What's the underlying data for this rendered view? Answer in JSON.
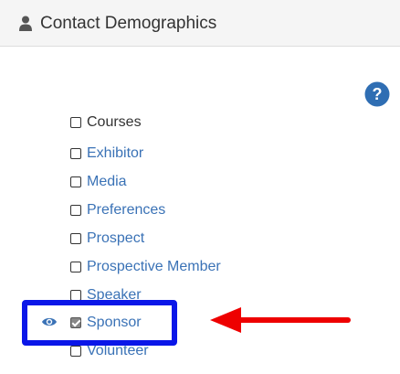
{
  "header": {
    "title": "Contact Demographics",
    "icon": "user-icon"
  },
  "help": {
    "icon": "question-circle-icon"
  },
  "checkboxes": [
    {
      "label": "Courses",
      "checked": false
    },
    {
      "label": "Exhibitor",
      "checked": false
    },
    {
      "label": "Media",
      "checked": false
    },
    {
      "label": "Preferences",
      "checked": false
    },
    {
      "label": "Prospect",
      "checked": false
    },
    {
      "label": "Prospective Member",
      "checked": false
    },
    {
      "label": "Speaker",
      "checked": false
    },
    {
      "label": "Sponsor",
      "checked": true
    },
    {
      "label": "Volunteer",
      "checked": false
    }
  ],
  "annotations": {
    "highlight_color": "#0a16e8",
    "arrow_color": "#ee0000"
  }
}
